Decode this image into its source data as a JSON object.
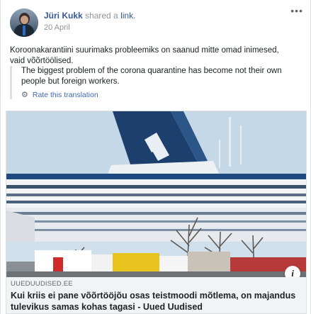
{
  "post": {
    "author": "Jüri Kukk",
    "action_text": "shared a",
    "action_link": "link.",
    "date": "20 April",
    "more_label": "•••",
    "text": "Koroonakarantiini suurimaks probleemiks on saanud mitte omad inimesed, vaid võõrtöölised.",
    "translation": "The biggest problem of the corona quarantine has become not their own people but foreign workers.",
    "rate_translation": "Rate this translation",
    "rate_icon": "gear-icon"
  },
  "link": {
    "domain": "UUEDUUDISED.EE",
    "headline": "Kui kriis ei pane võõrtööjõu osas teistmoodi mõtlema, on majandus tulevikus samas kohas tagasi - Uued Uudised",
    "info_icon_label": "i"
  },
  "colors": {
    "link_blue": "#365899",
    "secondary_text": "#90949c",
    "ship_funnel": "#1c3f6e",
    "sky": "#c9dbe8"
  }
}
